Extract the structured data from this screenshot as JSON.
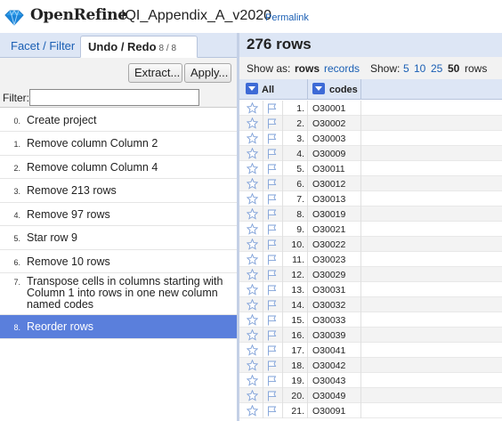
{
  "header": {
    "brand": "OpenRefine",
    "project_name": "IQI_Appendix_A_v2020",
    "permalink": "Permalink",
    "logo_icon": "diamond-icon"
  },
  "left": {
    "tabs": [
      {
        "label": "Facet / Filter"
      },
      {
        "label": "Undo / Redo",
        "count": "8 / 8"
      }
    ],
    "buttons": {
      "extract": "Extract...",
      "apply": "Apply..."
    },
    "filter": {
      "label": "Filter:",
      "value": ""
    },
    "history": [
      {
        "num": "0.",
        "text": "Create project"
      },
      {
        "num": "1.",
        "text": "Remove column Column 2"
      },
      {
        "num": "2.",
        "text": "Remove column Column 4"
      },
      {
        "num": "3.",
        "text": "Remove 213 rows"
      },
      {
        "num": "4.",
        "text": "Remove 97 rows"
      },
      {
        "num": "5.",
        "text": "Star row 9"
      },
      {
        "num": "6.",
        "text": "Remove 10 rows"
      },
      {
        "num": "7.",
        "text": "Transpose cells in columns starting with Column 1 into rows in one new column named codes"
      },
      {
        "num": "8.",
        "text": "Reorder rows",
        "current": true
      }
    ]
  },
  "right": {
    "row_count": "276 rows",
    "view": {
      "show_as": "Show as:",
      "rows": "rows",
      "records": "records",
      "show": "Show:",
      "sizes": [
        "5",
        "10",
        "25",
        "50"
      ],
      "selected_size": "50",
      "unit": "rows"
    },
    "columns": {
      "all": "All",
      "codes": "codes"
    },
    "rows": [
      {
        "idx": "1.",
        "code": "O30001"
      },
      {
        "idx": "2.",
        "code": "O30002"
      },
      {
        "idx": "3.",
        "code": "O30003"
      },
      {
        "idx": "4.",
        "code": "O30009"
      },
      {
        "idx": "5.",
        "code": "O30011"
      },
      {
        "idx": "6.",
        "code": "O30012"
      },
      {
        "idx": "7.",
        "code": "O30013"
      },
      {
        "idx": "8.",
        "code": "O30019"
      },
      {
        "idx": "9.",
        "code": "O30021"
      },
      {
        "idx": "10.",
        "code": "O30022"
      },
      {
        "idx": "11.",
        "code": "O30023"
      },
      {
        "idx": "12.",
        "code": "O30029"
      },
      {
        "idx": "13.",
        "code": "O30031"
      },
      {
        "idx": "14.",
        "code": "O30032"
      },
      {
        "idx": "15.",
        "code": "O30033"
      },
      {
        "idx": "16.",
        "code": "O30039"
      },
      {
        "idx": "17.",
        "code": "O30041"
      },
      {
        "idx": "18.",
        "code": "O30042"
      },
      {
        "idx": "19.",
        "code": "O30043"
      },
      {
        "idx": "20.",
        "code": "O30049"
      },
      {
        "idx": "21.",
        "code": "O30091"
      }
    ]
  },
  "colors": {
    "accent": "#5a7fdc",
    "panel": "#dde6f5",
    "link": "#1a5fb4",
    "dropdown": "#3d6ad6"
  }
}
